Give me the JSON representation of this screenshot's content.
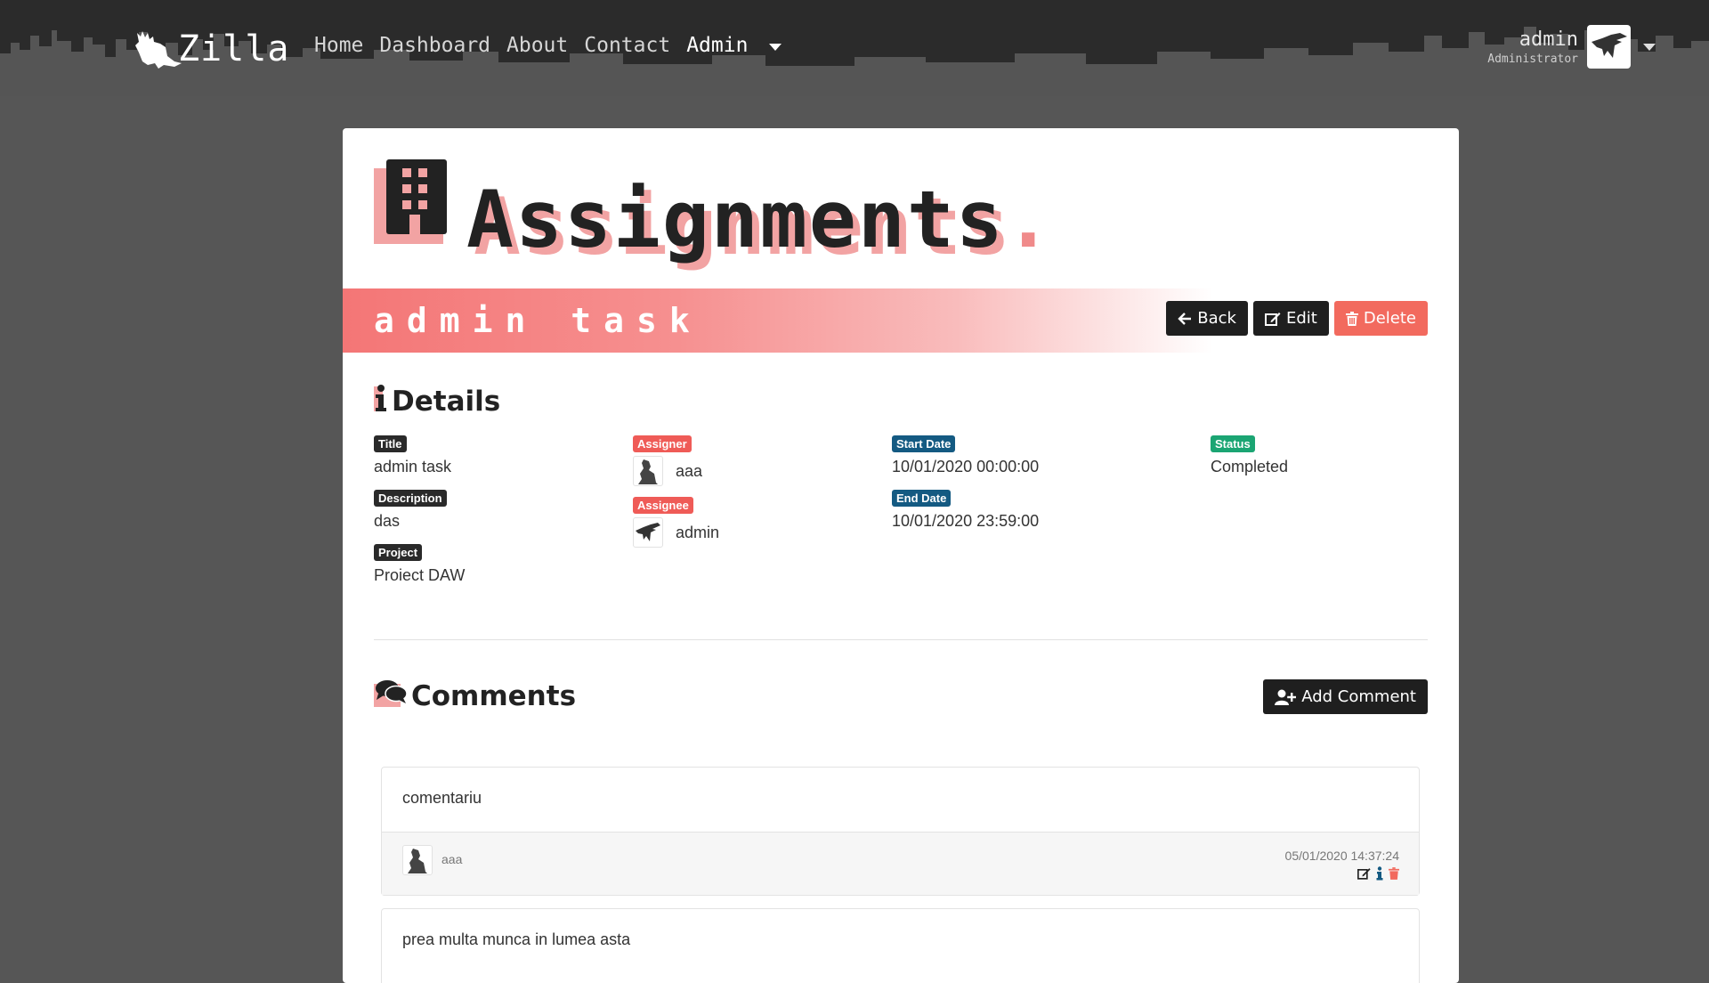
{
  "navbar": {
    "brand": "Zilla",
    "links": [
      {
        "label": "Home"
      },
      {
        "label": "Dashboard"
      },
      {
        "label": "About"
      },
      {
        "label": "Contact"
      },
      {
        "label": "Admin"
      }
    ],
    "user": {
      "name": "admin",
      "role": "Administrator"
    }
  },
  "page": {
    "title": "Assignments",
    "title_dot": ".",
    "task_name": "admin task",
    "actions": {
      "back": "Back",
      "edit": "Edit",
      "delete": "Delete"
    }
  },
  "details": {
    "heading": "Details",
    "title_label": "Title",
    "title_value": "admin task",
    "description_label": "Description",
    "description_value": "das",
    "project_label": "Project",
    "project_value": "Proiect DAW",
    "assigner_label": "Assigner",
    "assigner_value": "aaa",
    "assignee_label": "Assignee",
    "assignee_value": "admin",
    "start_label": "Start Date",
    "start_value": "10/01/2020 00:00:00",
    "end_label": "End Date",
    "end_value": "10/01/2020 23:59:00",
    "status_label": "Status",
    "status_value": "Completed"
  },
  "comments": {
    "heading": "Comments",
    "add_label": "Add Comment",
    "items": [
      {
        "text": "comentariu",
        "author": "aaa",
        "date": "05/01/2020 14:37:24"
      },
      {
        "text": "prea multa munca in lumea asta"
      }
    ]
  },
  "colors": {
    "accent": "#f47676",
    "dark": "#1f1f1f",
    "danger": "#f26a5e",
    "info_badge": "#145a82",
    "success_badge": "#1ba573"
  },
  "icons": [
    "godzilla-logo",
    "building-icon",
    "arrow-left-icon",
    "edit-icon",
    "trash-icon",
    "info-icon",
    "comments-icon",
    "user-plus-icon",
    "user-avatar-icon"
  ]
}
